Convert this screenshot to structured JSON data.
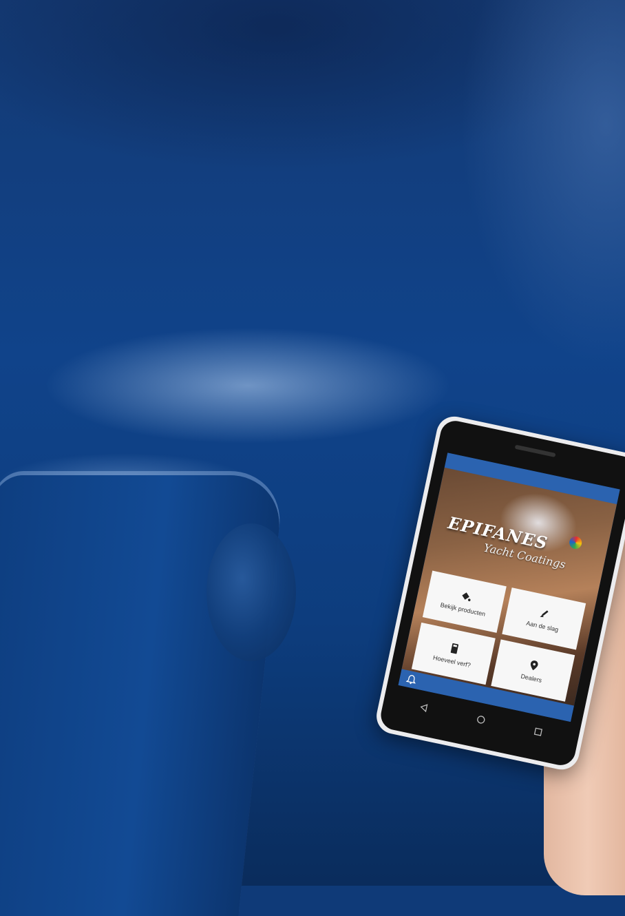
{
  "app": {
    "brand": "EPIFANES",
    "brand_sub": "Yacht Coatings"
  },
  "tiles": [
    {
      "label": "Bekijk producten",
      "icon": "paint-bucket-icon"
    },
    {
      "label": "Aan de slag",
      "icon": "paintbrush-icon"
    },
    {
      "label": "Hoeveel verf?",
      "icon": "calculator-icon"
    },
    {
      "label": "Dealers",
      "icon": "location-pin-icon"
    }
  ],
  "nav": {
    "notification_icon": "bell-icon"
  },
  "softkeys": [
    "back-icon",
    "home-icon",
    "recents-icon"
  ],
  "colors": {
    "accent": "#2b63b0",
    "background": "#0f3a78"
  }
}
